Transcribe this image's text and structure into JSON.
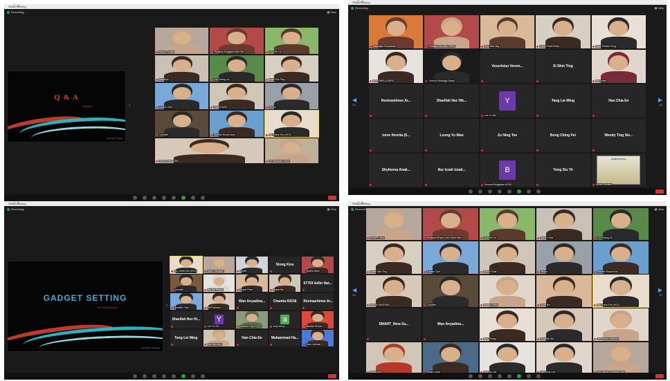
{
  "collage_title": "Zoom Meeting screenshots collage",
  "windows": [
    {
      "id": "q1",
      "title": "Zoom Meeting",
      "recording": "Recording...",
      "view": "View",
      "slide": {
        "title": "Q & A",
        "subtitle": "Speaker",
        "footer": "Copyright © 2021"
      },
      "tiles": [
        {
          "name": "Sarah Pumak",
          "c": "#c8a48a",
          "bg": "#b5a79b"
        },
        {
          "name": "Rodiana Songkara Adel Sen",
          "c": "#6b3a2e",
          "bg": "#b34a4a"
        },
        {
          "name": "Chui Ee Lin",
          "c": "#5a3a2a",
          "bg": "#8ab86a"
        },
        {
          "name": "Santhiya",
          "c": "#3a2a22",
          "bg": "#c9c1b6"
        },
        {
          "name": "Lim Zheng Lin",
          "c": "#2a2a2a",
          "bg": "#5a8a4a"
        },
        {
          "name": "Kaito Sim Ting",
          "c": "#3a2a22",
          "bg": "#d8cfc3"
        },
        {
          "name": "Lauren Cam",
          "c": "#2a2a2a",
          "bg": "#7aa9d9"
        },
        {
          "name": "Zainul Sulfa",
          "c": "#3a2a22",
          "bg": "#cfc6b8"
        },
        {
          "name": "Hirono",
          "c": "#2a2a2a",
          "bg": "#9aa0a8"
        },
        {
          "name": "Leoulele",
          "c": "#2a2a2a",
          "bg": "#5a4a3a"
        },
        {
          "name": "Maelah Rosari Ana",
          "c": "#3a2a22",
          "bg": "#6aa0d0"
        },
        {
          "name": "Rg. Daris Edu (HOJ)",
          "c": "#2a2a2a",
          "bg": "#e8dccb",
          "active": true
        },
        {
          "name": "ANGIX ANGKIAN",
          "c": "#3a2a22",
          "bg": "#d6c9b9"
        },
        {
          "name": "Sri Syazwan Yusuf",
          "c": "#c8a48a",
          "bg": "#c0b09a"
        }
      ]
    },
    {
      "id": "q2",
      "title": "Zoom Meeting",
      "recording": "Recording...",
      "view": "View",
      "page_left": "1/3",
      "page_right": "1/3",
      "tiles": [
        {
          "type": "video",
          "name": "Natarajah Rosnahbar",
          "c": "#6b3a2e",
          "bg": "#d97a3a"
        },
        {
          "type": "video",
          "name": "Rodiana Sen Brio TEKS",
          "c": "#c8a48a",
          "bg": "#b34a4a"
        },
        {
          "type": "video",
          "name": "Chui Wai Jing",
          "c": "#5a3a2a",
          "bg": "#d9b99a"
        },
        {
          "type": "video",
          "name": "Lionel Farid Rosin",
          "c": "#3a2a22",
          "bg": "#d8cfc3"
        },
        {
          "type": "video",
          "name": "Tiara Shahira Tong",
          "c": "#2a2a2a",
          "bg": "#e8e0d6"
        },
        {
          "type": "video",
          "name": "ROSOMELA SENG",
          "c": "#3a2a22",
          "bg": "#e6e2dd"
        },
        {
          "type": "video",
          "name": "Debora Husbagyi Sawal",
          "c": "#2a2a2a",
          "bg": "#1a1a1a"
        },
        {
          "type": "text",
          "label": "Veserleisu Verem...",
          "name": ""
        },
        {
          "type": "text",
          "label": "Si Shin Ting",
          "name": ""
        },
        {
          "type": "video",
          "name": "Nur Husni",
          "c": "#7a2a3a",
          "bg": "#e0d6cc"
        },
        {
          "type": "text",
          "label": "Revinashinee  Ar...",
          "name": ""
        },
        {
          "type": "text",
          "label": "Sharifah Nur Hik...",
          "name": ""
        },
        {
          "type": "letter",
          "letter": "Y",
          "color": "#6b3aa8",
          "name": "Lee Yu Gin"
        },
        {
          "type": "text",
          "label": "Tang Lie Ming",
          "name": ""
        },
        {
          "type": "text",
          "label": "Han Chia En",
          "name": ""
        },
        {
          "type": "text",
          "label": "irene fleretta (6...",
          "name": ""
        },
        {
          "type": "text",
          "label": "Leong Yu Wan",
          "name": ""
        },
        {
          "type": "text",
          "label": "Zu Ning Tee",
          "name": ""
        },
        {
          "type": "text",
          "label": "Bong Ching Fei",
          "name": ""
        },
        {
          "type": "text",
          "label": "Wendy Ting Sie...",
          "name": ""
        },
        {
          "type": "text",
          "label": "Shylienna  Anak...",
          "name": ""
        },
        {
          "type": "text",
          "label": "Nur Izzah Izzati...",
          "name": ""
        },
        {
          "type": "letter",
          "letter": "B",
          "color": "#6b3aa8",
          "name": "Susana Bulagidian MOGI"
        },
        {
          "type": "text",
          "label": "Yong Siu Yii",
          "name": ""
        },
        {
          "type": "poster",
          "poster": "KOMATSUTALI",
          "name": "Kumar Mansuri"
        }
      ]
    },
    {
      "id": "q3",
      "title": "Zoom Meeting",
      "recording": "Recording...",
      "view": "View",
      "slide": {
        "title": "GADGET SETTING",
        "subtitle": "Be Professional",
        "footer": "Copyright © Meeting"
      },
      "tiles": [
        {
          "type": "video",
          "name": "Rg. Daris Edu (HOJ)",
          "c": "#2a2a2a",
          "bg": "#e8dccb",
          "active": true
        },
        {
          "type": "video",
          "name": "Syifa Husniyah",
          "c": "#c8a48a",
          "bg": "#b5a79b"
        },
        {
          "type": "video",
          "name": "Izzdin",
          "c": "#2a2a2a",
          "bg": "#cfd4da"
        },
        {
          "type": "text",
          "label": "Siong Kiss",
          "name": ""
        },
        {
          "type": "video",
          "name": "Nadira Nasir",
          "c": "#3a2a22",
          "bg": "#b34a4a"
        },
        {
          "type": "video",
          "name": "Leoulele",
          "c": "#2a2a2a",
          "bg": "#7a5a3a"
        },
        {
          "type": "video",
          "name": "Nur Ain Razak",
          "c": "#d9d6d0",
          "bg": "#e6e2dd"
        },
        {
          "type": "video",
          "name": "Bryan Fane",
          "c": "#2a2a2a",
          "bg": "#d9b99a"
        },
        {
          "type": "video",
          "name": "Kayla Nur",
          "c": "#3a2a22",
          "bg": "#cfc6b8"
        },
        {
          "type": "text",
          "label": "67769 Adlin Nat...",
          "name": ""
        },
        {
          "type": "video",
          "name": "Jennifer Cam",
          "c": "#2a2a2a",
          "bg": "#7aa9d9"
        },
        {
          "type": "video",
          "name": "Siti Rahmah",
          "c": "#3a2a22",
          "bg": "#d6c9b9"
        },
        {
          "type": "text",
          "label": "Wan  Anyadina...",
          "name": ""
        },
        {
          "type": "text",
          "label": "Chantia 69318",
          "name": ""
        },
        {
          "type": "text",
          "label": "Revinashinee  Ar...",
          "name": ""
        },
        {
          "type": "text",
          "label": "Sharifah Nur Hi...",
          "name": ""
        },
        {
          "type": "letter",
          "letter": "Y",
          "color": "#6b3aa8",
          "name": "Lee Yu Gin"
        },
        {
          "type": "video",
          "name": "Hebron Tuyud",
          "c": "#5a6a4a",
          "bg": "#8a9a7a"
        },
        {
          "type": "letter",
          "letter": "a",
          "color": "#4caf50",
          "name": "amy tenng"
        },
        {
          "type": "video",
          "name": "Maelah Rosari",
          "c": "#3a2a22",
          "bg": "#d94a3a"
        },
        {
          "type": "text",
          "label": "Tang Lie Ming",
          "name": ""
        },
        {
          "type": "video",
          "name": "Kiki Nur Aine",
          "c": "#c8a48a",
          "bg": "#cfc6b8"
        },
        {
          "type": "text",
          "label": "Han Chia En",
          "name": ""
        },
        {
          "type": "text",
          "label": "Muhammad  Ha...",
          "name": ""
        },
        {
          "type": "video",
          "name": "Sara Lamoan",
          "c": "#3a2a22",
          "bg": "#4a7ad9"
        }
      ]
    },
    {
      "id": "q4",
      "title": "Zoom Meeting",
      "recording": "Recording...",
      "view": "View",
      "page_left": "2/3",
      "page_right": "2/3",
      "tiles": [
        {
          "type": "video",
          "name": "SHAPP_Ana",
          "c": "#c8a48a",
          "bg": "#b5a79b"
        },
        {
          "type": "video",
          "name": "Rodiana Erryna Liew Seren Ben",
          "c": "#6b3a2e",
          "bg": "#b34a4a"
        },
        {
          "type": "video",
          "name": "Chui Ee Lin",
          "c": "#5a3a2a",
          "bg": "#8ab86a"
        },
        {
          "type": "video",
          "name": "Karen Chee",
          "c": "#3a2a22",
          "bg": "#c9c1b6"
        },
        {
          "type": "video",
          "name": "Lim Zheng Lin",
          "c": "#2a2a2a",
          "bg": "#5a8a4a"
        },
        {
          "type": "video",
          "name": "Karen Sim Ting",
          "c": "#3a2a22",
          "bg": "#d8cfc3"
        },
        {
          "type": "video",
          "name": "Lauren Cam",
          "c": "#2a2a2a",
          "bg": "#7aa9d9"
        },
        {
          "type": "video",
          "name": "Zainul Sulfa",
          "c": "#3a2a22",
          "bg": "#cfc6b8"
        },
        {
          "type": "video",
          "name": "Hirono",
          "c": "#2a2a2a",
          "bg": "#9aa0a8"
        },
        {
          "type": "video",
          "name": "Maelah Rosari Ana",
          "c": "#3a2a22",
          "bg": "#6aa0d0"
        },
        {
          "type": "video",
          "name": "ANGIX ANGKIAN",
          "c": "#3a2a22",
          "bg": "#d6c9b9"
        },
        {
          "type": "video",
          "name": "Leoulele",
          "c": "#2a2a2a",
          "bg": "#5a4a3a"
        },
        {
          "type": "video",
          "name": "Nadira Sofea",
          "c": "#c8a48a",
          "bg": "#e0d6cc"
        },
        {
          "type": "video",
          "name": "Syifa Nur",
          "c": "#3a2a22",
          "bg": "#d9b99a"
        },
        {
          "type": "video",
          "name": "Rg. Daris Edu (HOJ)",
          "c": "#2a2a2a",
          "bg": "#e8dccb",
          "active": true
        },
        {
          "type": "text",
          "label": "SMART_Nina  Su...",
          "name": ""
        },
        {
          "type": "text",
          "label": "Wan  Anyadina...",
          "name": ""
        },
        {
          "type": "video",
          "name": "Amy Tenng",
          "c": "#3a2a22",
          "bg": "#e8e0d6"
        },
        {
          "type": "video",
          "name": "Sharifah Nur",
          "c": "#2a2a2a",
          "bg": "#d6c9b9"
        },
        {
          "type": "video",
          "name": "Nur Husni Cantona",
          "c": "#c8a48a",
          "bg": "#e0d6cc"
        },
        {
          "type": "video",
          "name": "Mohd Amri",
          "c": "#b33a2a",
          "bg": "#cfc6b8"
        },
        {
          "type": "video",
          "name": "Rosa Lunan",
          "c": "#3a2a22",
          "bg": "#4a6a8a"
        },
        {
          "type": "video",
          "name": "Lee Siu Jan",
          "c": "#2a2a2a",
          "bg": "#e6e2dd"
        },
        {
          "type": "video",
          "name": "Lee Tong Lee",
          "c": "#2a2a2a",
          "bg": "#e0d6cc"
        },
        {
          "type": "video",
          "name": "Nur Aisyah Syafinaz Dizn",
          "c": "#c8a48a",
          "bg": "#b5a79b"
        }
      ]
    }
  ]
}
